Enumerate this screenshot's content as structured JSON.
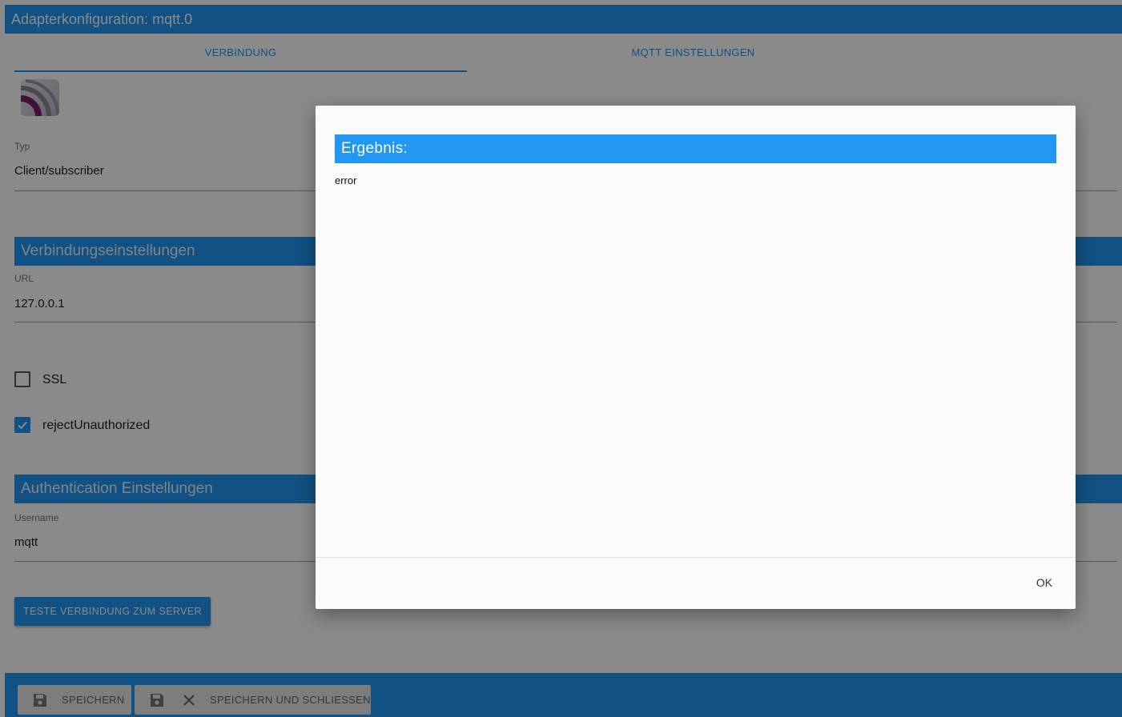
{
  "window": {
    "title": "Adapterkonfiguration: mqtt.0"
  },
  "tabs": [
    {
      "label": "VERBINDUNG",
      "active": true
    },
    {
      "label": "MQTT EINSTELLUNGEN",
      "active": false
    }
  ],
  "form": {
    "type": {
      "label": "Typ",
      "value": "Client/subscriber"
    },
    "connection_section": "Verbindungseinstellungen",
    "url": {
      "label": "URL",
      "value": "127.0.0.1"
    },
    "ssl": {
      "label": "SSL",
      "checked": false
    },
    "reject_unauthorized": {
      "label": "rejectUnauthorized",
      "checked": true
    },
    "auth_section": "Authentication Einstellungen",
    "username": {
      "label": "Username",
      "value": "mqtt"
    },
    "test_button": "TESTE VERBINDUNG ZUM SERVER"
  },
  "footer": {
    "save": "SPEICHERN",
    "save_close": "SPEICHERN UND SCHLIESSEN"
  },
  "dialog": {
    "title": "Ergebnis:",
    "message": "error",
    "ok": "OK"
  },
  "colors": {
    "accent": "#2196f3",
    "logo_purple": "#7b1f6e"
  }
}
